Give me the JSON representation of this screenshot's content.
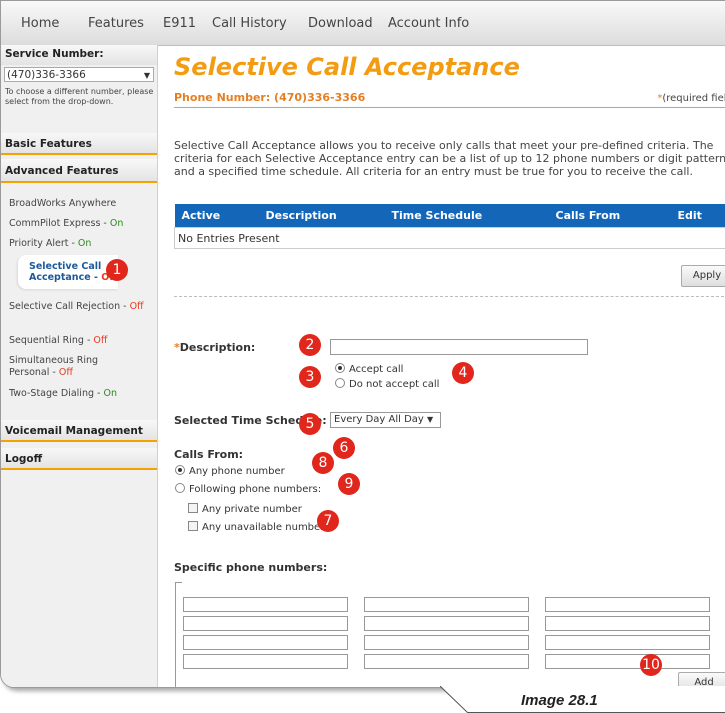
{
  "nav": [
    "Home",
    "Features",
    "E911",
    "Call History",
    "Download",
    "Account Info"
  ],
  "sidebar": {
    "service_number_label": "Service Number:",
    "service_number_value": "(470)336-3366",
    "hint": "To choose a different number, please select from the drop-down.",
    "basic_features": "Basic Features",
    "advanced_features": "Advanced Features",
    "items": [
      {
        "name": "BroadWorks Anywhere",
        "status": ""
      },
      {
        "name": "CommPilot Express - ",
        "status": "On"
      },
      {
        "name": "Priority Alert - ",
        "status": "On"
      },
      {
        "name": "Selective Call Rejection - ",
        "status": "Off"
      },
      {
        "name": "Sequential Ring - ",
        "status": "Off"
      },
      {
        "name": "Simultaneous Ring Personal - ",
        "status": "Off"
      },
      {
        "name": "Two-Stage Dialing - ",
        "status": "On"
      }
    ],
    "active_item": {
      "name": "Selective Call Acceptance - ",
      "status": "Off"
    },
    "voicemail": "Voicemail Management",
    "logoff": "Logoff"
  },
  "main": {
    "title": "Selective Call Acceptance",
    "phone_number": "Phone Number: (470)336-3366",
    "required_star": "*",
    "required_text": "(required fields)",
    "description": "Selective Call Acceptance allows you to receive only calls that meet your pre-defined criteria. The criteria for each Selective Acceptance entry can be a list of up to 12 phone numbers or digit patterns and a specified time schedule. All criteria for an entry must be true for you to receive the call.",
    "table": {
      "headers": [
        "Active",
        "Description",
        "Time Schedule",
        "Calls From",
        "Edit"
      ],
      "empty_text": "No Entries Present"
    },
    "apply_button": "Apply",
    "form": {
      "description_star": "*",
      "description_label": "Description:",
      "accept_call": "Accept call",
      "do_not_accept_call": "Do not accept call",
      "time_schedule_label": "Selected Time Schedule:",
      "time_schedule_value": "Every Day All Day",
      "calls_from_label": "Calls From:",
      "any_phone_number": "Any phone number",
      "following_phone_numbers": "Following phone numbers:",
      "any_private_number": "Any private number",
      "any_unavailable_number": "Any unavailable number",
      "specific_phone_numbers_label": "Specific phone numbers:"
    },
    "add_button": "Add"
  },
  "callouts": [
    "1",
    "2",
    "3",
    "4",
    "5",
    "6",
    "7",
    "8",
    "9",
    "10"
  ],
  "caption": "Image 28.1",
  "colors": {
    "accent_orange": "#f39c12",
    "table_header_blue": "#1466b8",
    "on_green": "#2c8a1b",
    "off_red": "#e53b1e",
    "callout_red": "#e1261c"
  }
}
